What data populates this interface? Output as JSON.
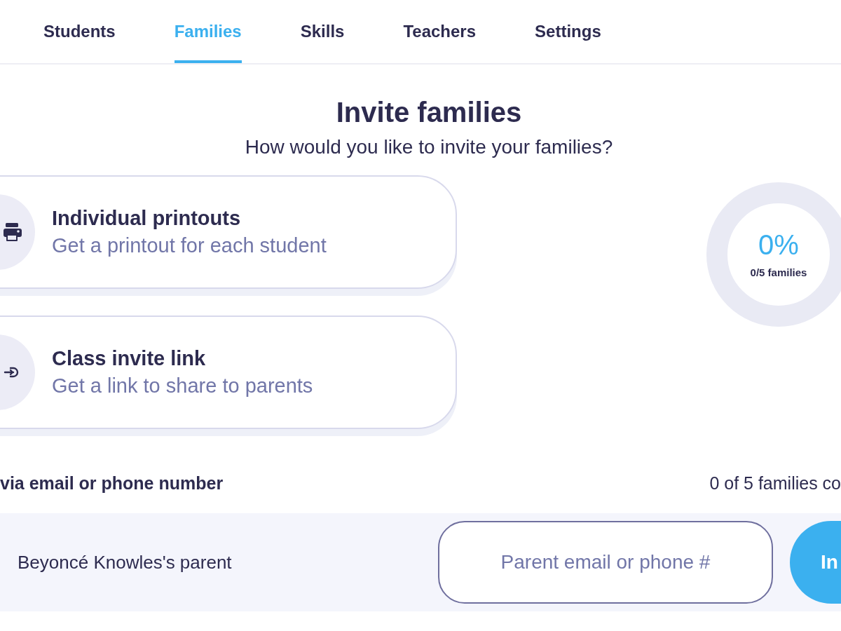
{
  "tabs": [
    {
      "label": "Students",
      "selected": false
    },
    {
      "label": "Families",
      "selected": true
    },
    {
      "label": "Skills",
      "selected": false
    },
    {
      "label": "Teachers",
      "selected": false
    },
    {
      "label": "Settings",
      "selected": false
    }
  ],
  "heading": {
    "title": "Invite families",
    "subtitle": "How would you like to invite your families?"
  },
  "options": [
    {
      "kind": "printer",
      "title": "Individual printouts",
      "description": "Get a printout for each student"
    },
    {
      "kind": "link",
      "title": "Class invite link",
      "description": "Get a link to share to parents"
    }
  ],
  "progress": {
    "percent": "0%",
    "caption": "0/5 families",
    "level": 0
  },
  "email_section": {
    "label": "via email or phone number",
    "count": "0 of 5 families co",
    "rows": [
      {
        "name": "Beyoncé Knowles's parent",
        "placeholder": "Parent email or phone #",
        "button": "In"
      }
    ]
  }
}
